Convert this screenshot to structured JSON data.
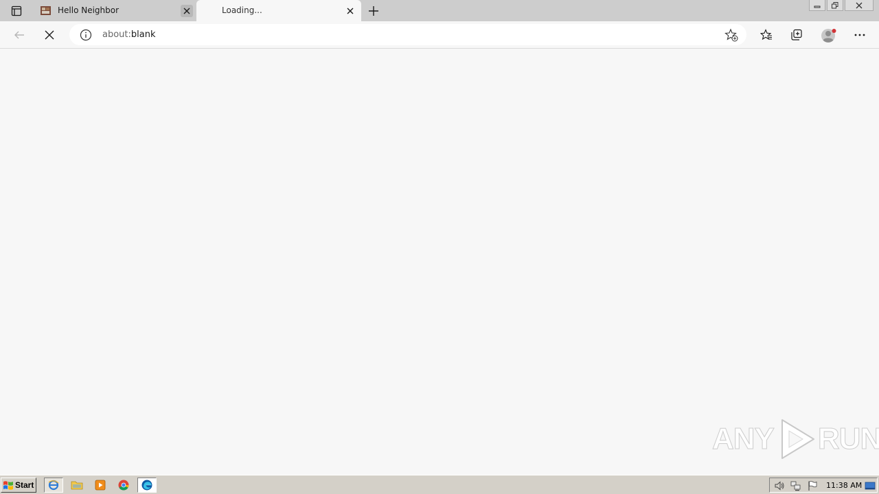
{
  "browser": {
    "tabs": [
      {
        "title": "Hello Neighbor",
        "active": false
      },
      {
        "title": "Loading...",
        "active": true
      }
    ],
    "address": {
      "scheme": "about:",
      "path": "blank"
    }
  },
  "watermark": {
    "text_left": "ANY",
    "text_right": "RUN"
  },
  "taskbar": {
    "start_label": "Start",
    "clock": "11:38 AM"
  },
  "colors": {
    "tabstrip": "#cdcdcd",
    "content": "#f7f7f7",
    "taskbar": "#d4d0c8",
    "profile_badge": "#d13438"
  }
}
